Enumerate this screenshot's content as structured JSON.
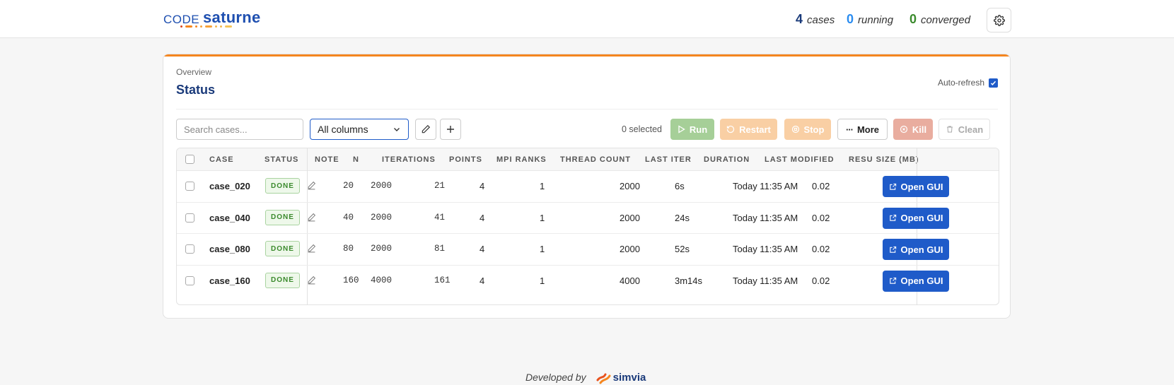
{
  "logo": {
    "code": "CODE",
    "saturne": "saturne"
  },
  "header": {
    "cases_count": "4",
    "cases_label": "cases",
    "running_count": "0",
    "running_label": "running",
    "converged_count": "0",
    "converged_label": "converged"
  },
  "card": {
    "overview": "Overview",
    "title": "Status",
    "autorefresh_label": "Auto-refresh",
    "autorefresh_checked": true
  },
  "toolbar": {
    "search_placeholder": "Search cases...",
    "columns_select": "All columns",
    "selected_text": "0 selected",
    "run": "Run",
    "restart": "Restart",
    "stop": "Stop",
    "more": "More",
    "kill": "Kill",
    "clean": "Clean"
  },
  "table": {
    "headers": [
      "CASE",
      "STATUS",
      "NOTE",
      "N",
      "ITERATIONS",
      "POINTS",
      "MPI RANKS",
      "THREAD COUNT",
      "LAST ITER",
      "DURATION",
      "LAST MODIFIED",
      "RESU SIZE (MB)"
    ],
    "rows": [
      {
        "case": "case_020",
        "status": "DONE",
        "n": "20",
        "iterations": "2000",
        "points": "21",
        "mpi": "4",
        "threads": "1",
        "last_iter": "2000",
        "duration": "6s",
        "modified": "Today 11:35 AM",
        "size": "0.02"
      },
      {
        "case": "case_040",
        "status": "DONE",
        "n": "40",
        "iterations": "2000",
        "points": "41",
        "mpi": "4",
        "threads": "1",
        "last_iter": "2000",
        "duration": "24s",
        "modified": "Today 11:35 AM",
        "size": "0.02"
      },
      {
        "case": "case_080",
        "status": "DONE",
        "n": "80",
        "iterations": "2000",
        "points": "81",
        "mpi": "4",
        "threads": "1",
        "last_iter": "2000",
        "duration": "52s",
        "modified": "Today 11:35 AM",
        "size": "0.02"
      },
      {
        "case": "case_160",
        "status": "DONE",
        "n": "160",
        "iterations": "4000",
        "points": "161",
        "mpi": "4",
        "threads": "1",
        "last_iter": "4000",
        "duration": "3m14s",
        "modified": "Today 11:35 AM",
        "size": "0.02"
      }
    ],
    "open_gui_label": "Open GUI"
  },
  "footer": {
    "developed_by": "Developed by",
    "brand": "simvia"
  },
  "colors": {
    "primary": "#1f5bc9",
    "accent_orange": "#f5861f",
    "running_blue": "#2a8cf0",
    "converged_green": "#3a8a2c",
    "navy": "#1a3a7a"
  },
  "icons": [
    "gear-icon",
    "pencil-icon",
    "plus-icon",
    "play-icon",
    "restart-icon",
    "stop-icon",
    "more-icon",
    "kill-icon",
    "trash-icon",
    "external-link-icon",
    "chevron-down-icon",
    "check-icon"
  ]
}
